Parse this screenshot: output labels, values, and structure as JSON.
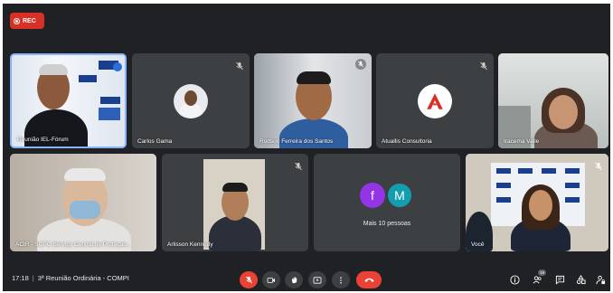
{
  "recording": {
    "label": "REC"
  },
  "tiles": [
    {
      "name": "Reunião IEL-Fórum"
    },
    {
      "name": "Carlos Gama"
    },
    {
      "name": "Rodson Ferreira dos Santos"
    },
    {
      "name": "Atuallis Consultoria"
    },
    {
      "name": "Iracema Valle"
    },
    {
      "name": "ACIR - SCPC-Serviço Central de Proteçao..."
    },
    {
      "name": "Arlisson Kennedy"
    },
    {
      "name": "Mais 10 pessoas",
      "avatars": [
        "f",
        "M"
      ]
    },
    {
      "name": "Você"
    }
  ],
  "bottom_bar": {
    "time": "17:18",
    "separator": "|",
    "meeting_title": "3ª Reunião Ordinária - COMPI",
    "participant_count": "19"
  },
  "colors": {
    "background": "#202124",
    "tile": "#3c4043",
    "red": "#ea4335",
    "avatar_f": "#9334e6",
    "avatar_m": "#129eaf"
  }
}
